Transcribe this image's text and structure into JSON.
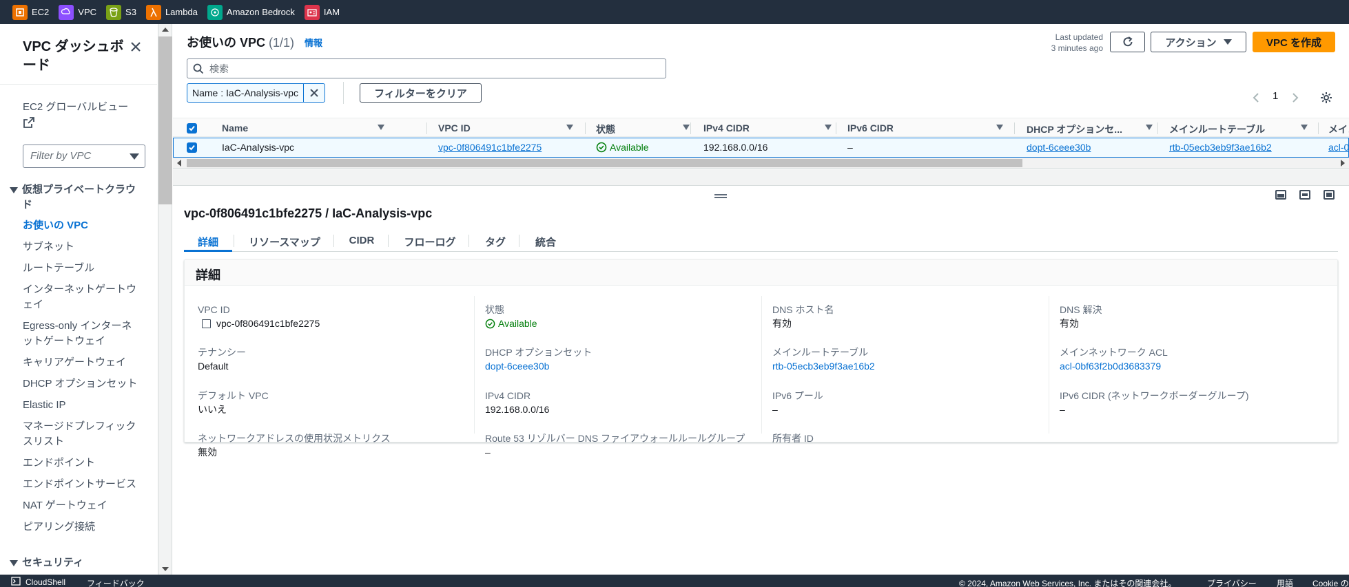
{
  "favorites": [
    {
      "label": "EC2",
      "color": "#ed7100",
      "icon": "ec2-icon"
    },
    {
      "label": "VPC",
      "color": "#8c4fff",
      "icon": "vpc-icon"
    },
    {
      "label": "S3",
      "color": "#7aa116",
      "icon": "s3-icon"
    },
    {
      "label": "Lambda",
      "color": "#ed7100",
      "icon": "lambda-icon"
    },
    {
      "label": "Amazon Bedrock",
      "color": "#01a88d",
      "icon": "bedrock-icon"
    },
    {
      "label": "IAM",
      "color": "#dd344c",
      "icon": "iam-icon"
    }
  ],
  "sidebar": {
    "title": "VPC ダッシュボード",
    "global_view": "EC2 グローバルビュー",
    "filter_placeholder": "Filter by VPC",
    "section1": "仮想プライベートクラウド",
    "items": [
      "お使いの VPC",
      "サブネット",
      "ルートテーブル",
      "インターネットゲートウェイ",
      "Egress-only インターネットゲートウェイ",
      "キャリアゲートウェイ",
      "DHCP オプションセット",
      "Elastic IP",
      "マネージドプレフィックスリスト",
      "エンドポイント",
      "エンドポイントサービス",
      "NAT ゲートウェイ",
      "ピアリング接続"
    ],
    "section2": "セキュリティ"
  },
  "header": {
    "title": "お使いの VPC",
    "count": "(1/1)",
    "info": "情報",
    "last_updated_line1": "Last updated",
    "last_updated_line2": "3 minutes ago",
    "actions_label": "アクション",
    "create_label": "VPC を作成"
  },
  "search": {
    "placeholder": "検索"
  },
  "filter_token": {
    "label": "Name : IaC-Analysis-vpc",
    "clear_label": "フィルターをクリア"
  },
  "pagination": {
    "page": "1"
  },
  "table": {
    "columns": [
      "Name",
      "VPC ID",
      "状態",
      "IPv4 CIDR",
      "IPv6 CIDR",
      "DHCP オプションセ...",
      "メインルートテーブル",
      "メイン"
    ],
    "row": {
      "name": "IaC-Analysis-vpc",
      "vpc_id": "vpc-0f806491c1bfe2275",
      "state": "Available",
      "ipv4": "192.168.0.0/16",
      "ipv6": "–",
      "dhcp": "dopt-6ceee30b",
      "route_table": "rtb-05ecb3eb9f3ae16b2",
      "acl": "acl-0"
    }
  },
  "details": {
    "title": "vpc-0f806491c1bfe2275 / IaC-Analysis-vpc",
    "tabs": [
      "詳細",
      "リソースマップ",
      "CIDR",
      "フローログ",
      "タグ",
      "統合"
    ],
    "panel_title": "詳細",
    "fields": {
      "vpc_id_label": "VPC ID",
      "vpc_id": "vpc-0f806491c1bfe2275",
      "tenancy_label": "テナンシー",
      "tenancy": "Default",
      "default_vpc_label": "デフォルト VPC",
      "default_vpc": "いいえ",
      "net_metric_label": "ネットワークアドレスの使用状況メトリクス",
      "net_metric": "無効",
      "state_label": "状態",
      "state": "Available",
      "dhcp_label": "DHCP オプションセット",
      "dhcp": "dopt-6ceee30b",
      "ipv4_label": "IPv4 CIDR",
      "ipv4": "192.168.0.0/16",
      "route53_label": "Route 53 リゾルバー DNS ファイアウォールルールグループ",
      "route53": "–",
      "dns_host_label": "DNS ホスト名",
      "dns_host": "有効",
      "main_rt_label": "メインルートテーブル",
      "main_rt": "rtb-05ecb3eb9f3ae16b2",
      "ipv6_pool_label": "IPv6 プール",
      "ipv6_pool": "–",
      "owner_label": "所有者 ID",
      "owner": "",
      "dns_res_label": "DNS 解決",
      "dns_res": "有効",
      "main_acl_label": "メインネットワーク ACL",
      "main_acl": "acl-0bf63f2b0d3683379",
      "ipv6_cidr_label": "IPv6 CIDR (ネットワークボーダーグループ)",
      "ipv6_cidr": "–"
    }
  },
  "footer": {
    "cloudshell": "CloudShell",
    "feedback": "フィードバック",
    "copyright": "© 2024, Amazon Web Services, Inc. またはその関連会社。",
    "privacy": "プライバシー",
    "terms": "用語",
    "cookie": "Cookie の"
  }
}
